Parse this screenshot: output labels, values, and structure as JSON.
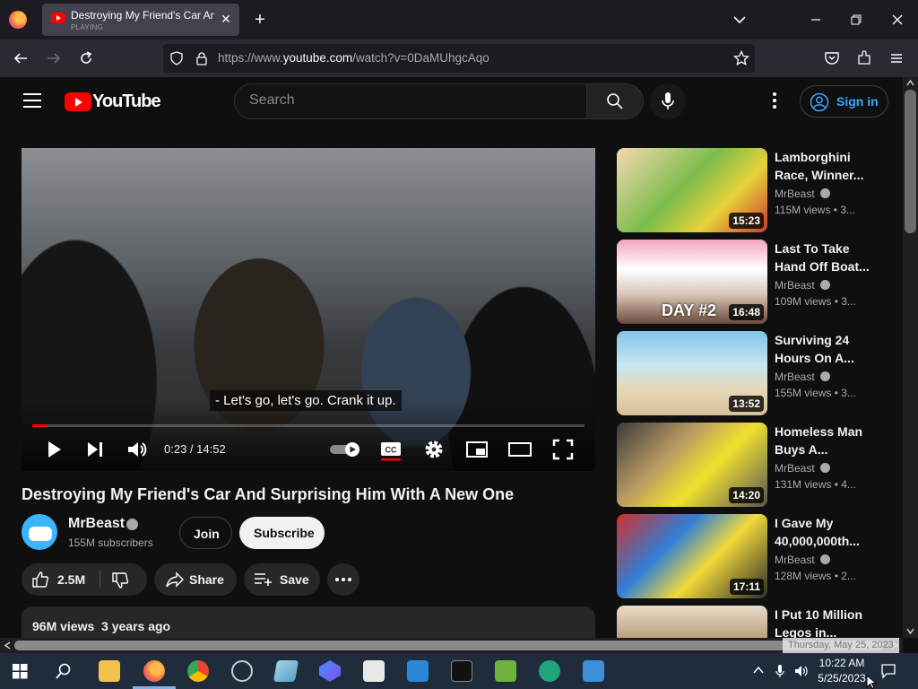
{
  "browser": {
    "tab_title": "Destroying My Friend's Car And Surprising Him With A New One",
    "tab_status": "PLAYING",
    "new_tab": "+",
    "url_prefix": "https://www.",
    "url_domain": "youtube.com",
    "url_path": "/watch?v=0DaMUhgcAqo"
  },
  "youtube": {
    "logo_text": "YouTube",
    "search_placeholder": "Search",
    "sign_in": "Sign in"
  },
  "player": {
    "caption": "- Let's go, let's go. Crank it up.",
    "current_time": "0:23",
    "time_sep": " / ",
    "duration": "14:52",
    "progress_fraction": 0.026
  },
  "video": {
    "title": "Destroying My Friend's Car And Surprising Him With A New One",
    "channel": "MrBeast",
    "subscribers": "155M subscribers",
    "join": "Join",
    "subscribe": "Subscribe",
    "likes": "2.5M",
    "share": "Share",
    "save": "Save",
    "views": "96M views",
    "age": "3 years ago"
  },
  "recommendations": [
    {
      "title": "Lamborghini Race, Winner...",
      "channel": "MrBeast",
      "meta": "115M views • 3...",
      "duration": "15:23"
    },
    {
      "title": "Last To Take Hand Off Boat...",
      "channel": "MrBeast",
      "meta": "109M views • 3...",
      "duration": "16:48",
      "badge": "DAY #2"
    },
    {
      "title": "Surviving 24 Hours On A...",
      "channel": "MrBeast",
      "meta": "155M views • 3...",
      "duration": "13:52"
    },
    {
      "title": "Homeless Man Buys A...",
      "channel": "MrBeast",
      "meta": "131M views • 4...",
      "duration": "14:20"
    },
    {
      "title": "I Gave My 40,000,000th...",
      "channel": "MrBeast",
      "meta": "128M views • 2...",
      "duration": "17:11"
    },
    {
      "title": "I Put 10 Million Legos in...",
      "channel": "",
      "meta": "",
      "duration": ""
    }
  ],
  "taskbar": {
    "time": "10:22 AM",
    "date": "5/25/2023",
    "tooltip": "Thursday, May 25, 2023"
  },
  "colors": {
    "accent": "#ff0000",
    "link": "#3ea6ff",
    "background": "#0f0f0f"
  }
}
